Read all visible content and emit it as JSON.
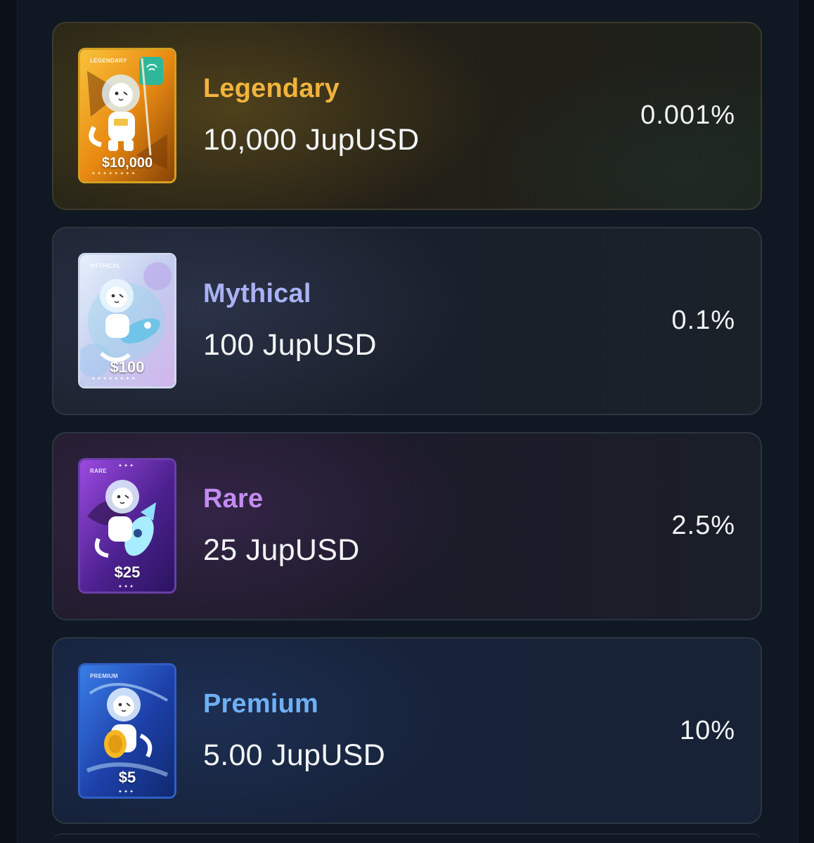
{
  "tiers": [
    {
      "rarity_label": "LEGENDARY",
      "name": "Legendary",
      "amount": "10,000 JupUSD",
      "odds": "0.001%",
      "card_price": "$10,000",
      "name_color": "#f2b33d",
      "card_colors": [
        "#f6a91e",
        "#e07b0c",
        "#7a3d06"
      ]
    },
    {
      "rarity_label": "MYTHICAL",
      "name": "Mythical",
      "amount": "100 JupUSD",
      "odds": "0.1%",
      "card_price": "$100",
      "name_color": "#a9b2f5",
      "card_colors": [
        "#d7e4f7",
        "#b8c6ec",
        "#c9a6e8"
      ]
    },
    {
      "rarity_label": "RARE",
      "name": "Rare",
      "amount": "25 JupUSD",
      "odds": "2.5%",
      "card_price": "$25",
      "name_color": "#c38cf2",
      "card_colors": [
        "#8a3fd0",
        "#4a1f8a",
        "#2a1460"
      ]
    },
    {
      "rarity_label": "PREMIUM",
      "name": "Premium",
      "amount": "5.00 JupUSD",
      "odds": "10%",
      "card_price": "$5",
      "name_color": "#6fb0f4",
      "card_colors": [
        "#2f6fe0",
        "#1d3fa8",
        "#0f2a70"
      ]
    }
  ]
}
